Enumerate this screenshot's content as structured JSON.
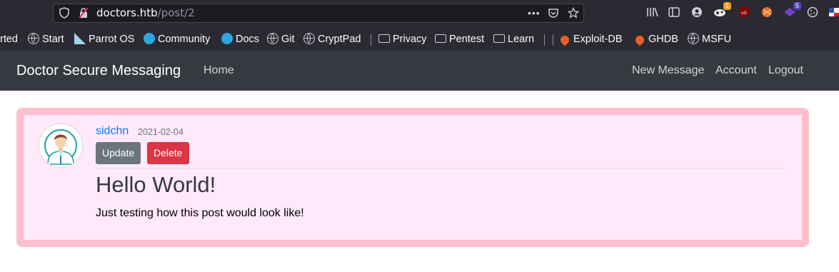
{
  "browser": {
    "url_host": "doctors.htb",
    "url_path": "/post/2",
    "badges": {
      "ext1": "1",
      "ext2": "5"
    },
    "bookmarks": [
      {
        "label": "rted",
        "icon": "none"
      },
      {
        "label": "Start",
        "icon": "globe-icon"
      },
      {
        "label": "Parrot OS",
        "icon": "parrot-icon"
      },
      {
        "label": "Community",
        "icon": "parrot-community-icon"
      },
      {
        "label": "Docs",
        "icon": "parrot-docs-icon"
      },
      {
        "label": "Git",
        "icon": "globe-icon"
      },
      {
        "label": "CryptPad",
        "icon": "globe-icon"
      },
      {
        "label": "Privacy",
        "icon": "folder-icon"
      },
      {
        "label": "Pentest",
        "icon": "folder-icon"
      },
      {
        "label": "Learn",
        "icon": "folder-icon"
      },
      {
        "label": "Exploit-DB",
        "icon": "exploit-db-icon"
      },
      {
        "label": "GHDB",
        "icon": "exploit-db-icon"
      },
      {
        "label": "MSFU",
        "icon": "globe-icon"
      }
    ]
  },
  "site": {
    "brand": "Doctor Secure Messaging",
    "nav_left": [
      "Home"
    ],
    "nav_right": [
      "New Message",
      "Account",
      "Logout"
    ]
  },
  "post": {
    "author": "sidchn",
    "date": "2021-02-04",
    "update_label": "Update",
    "delete_label": "Delete",
    "title": "Hello World!",
    "content": "Just testing how this post would look like!"
  },
  "colors": {
    "navbar": "#343a40",
    "card_border": "#ffbfcc",
    "card_bg": "#ffe9fb",
    "link": "#007bff",
    "delete": "#dc3545",
    "update": "#6c757d"
  }
}
